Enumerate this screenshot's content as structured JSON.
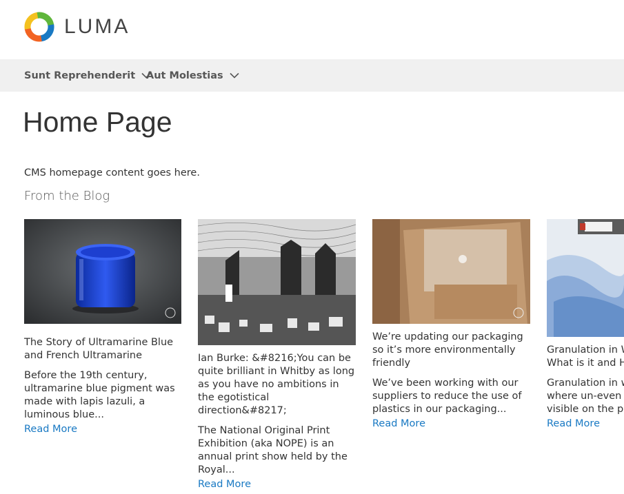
{
  "brand": {
    "name": "LUMA",
    "colors": {
      "orange": "#f26322",
      "blue": "#1979c3",
      "green": "#5fb63b",
      "yellow": "#f4c11f"
    }
  },
  "nav": {
    "items": [
      {
        "label": "Sunt Reprehenderit",
        "icon": "chevron-down-icon"
      },
      {
        "label": "Aut Molestias",
        "icon": "chevron-down-icon"
      }
    ]
  },
  "page": {
    "title": "Home Page",
    "cms_text": "CMS homepage content goes here."
  },
  "blog": {
    "heading": "From the Blog",
    "posts": [
      {
        "title": "The Story of Ultramarine Blue and French Ultramarine",
        "excerpt": "Before the 19th century, ultramarine blue pigment was made with lapis lazuli, a luminous blue...",
        "read_more": "Read More",
        "image": "jar of blue ultramarine pigment on dark slate"
      },
      {
        "title": "Ian Burke: &#8216;You can be quite brilliant in Whitby as long as you have no ambitions in the egotistical direction&#8217;",
        "excerpt": "The National Original Print Exhibition (aka NOPE) is an annual print show held by the Royal...",
        "read_more": "Read More",
        "image": "black and white etching of Whitby abbey and town"
      },
      {
        "title": "We’re updating our packaging so it’s more environmentally friendly",
        "excerpt": "We’ve been working with our suppliers to reduce the use of plastics in our packaging...",
        "read_more": "Read More",
        "image": "kraft paper envelopes and cardboard packaging"
      },
      {
        "title": "Granulation in Watercolour: What is it and How...",
        "title_visible": "Granulation in W",
        "title_visible_2": "What is it and Ho",
        "excerpt_visible": [
          "Granulation in w",
          "where un-even p",
          "visible on the pa"
        ],
        "read_more": "Read More",
        "image": "blue watercolour wash with paint tube"
      }
    ]
  }
}
